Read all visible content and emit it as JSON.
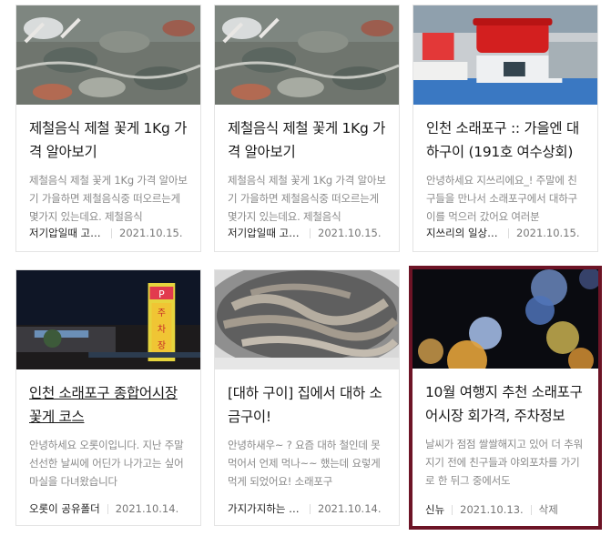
{
  "cards": [
    {
      "title": "제철음식 제철 꽃게 1Kg 가격 알아보기",
      "excerpt": "제철음식 제철 꽃게 1Kg 가격 알아보기 가을하면 제철음식중 떠오르는게 몇가지 있는데요. 제철음식",
      "author": "저기압일때 고기앞으로",
      "date": "2021.10.15.",
      "image": "crabs-in-basin"
    },
    {
      "title": "제철음식 제철 꽃게 1Kg 가격 알아보기",
      "excerpt": "제철음식 제철 꽃게 1Kg 가격 알아보기 가을하면 제철음식중 떠오르는게 몇가지 있는데요. 제철음식",
      "author": "저기압일때 고기앞으로",
      "date": "2021.10.15.",
      "image": "crabs-in-basin"
    },
    {
      "title": "인천 소래포구 :: 가을엔 대하구이 (191호 여수상회)",
      "excerpt": "안녕하세요 지쓰리에요_! 주말에 친구들을 만나서 소래포구에서 대하구이를 먹으러 갔어요 여러분",
      "author": "지쓰리의 일상기록",
      "date": "2021.10.15.",
      "image": "market-scale-red-pot"
    },
    {
      "title": "인천 소래포구 종합어시장 꽃게 코스",
      "excerpt": "안녕하세요 오롯이입니다. 지난 주말 선선한 날씨에 어딘가 나가고는 싶어 마실을 다녀왔습니다",
      "author": "오롯이 공유폴더",
      "date": "2021.10.14.",
      "image": "night-parking-sign"
    },
    {
      "title": "[대하 구이] 집에서 대하 소금구이!",
      "excerpt": "안녕하새우~ ? 요즘 대하 철인데 못 먹어서 언제 먹나~~ 했는데 요렇게 먹게 되었어요! 소래포구",
      "author": "가지가지하는 가지",
      "date": "2021.10.14.",
      "image": "shrimp-pan"
    },
    {
      "title": "10월 여행지 추천 소래포구 어시장 회가격, 주차정보",
      "excerpt": "날씨가 점점 쌀쌀해지고 있어 더 추워지기 전에 친구들과 야외포차를 가기로 한 뒤그 중에서도",
      "author": "신뉴",
      "date": "2021.10.13.",
      "delete_label": "삭제",
      "image": "bokeh-lights"
    }
  ]
}
